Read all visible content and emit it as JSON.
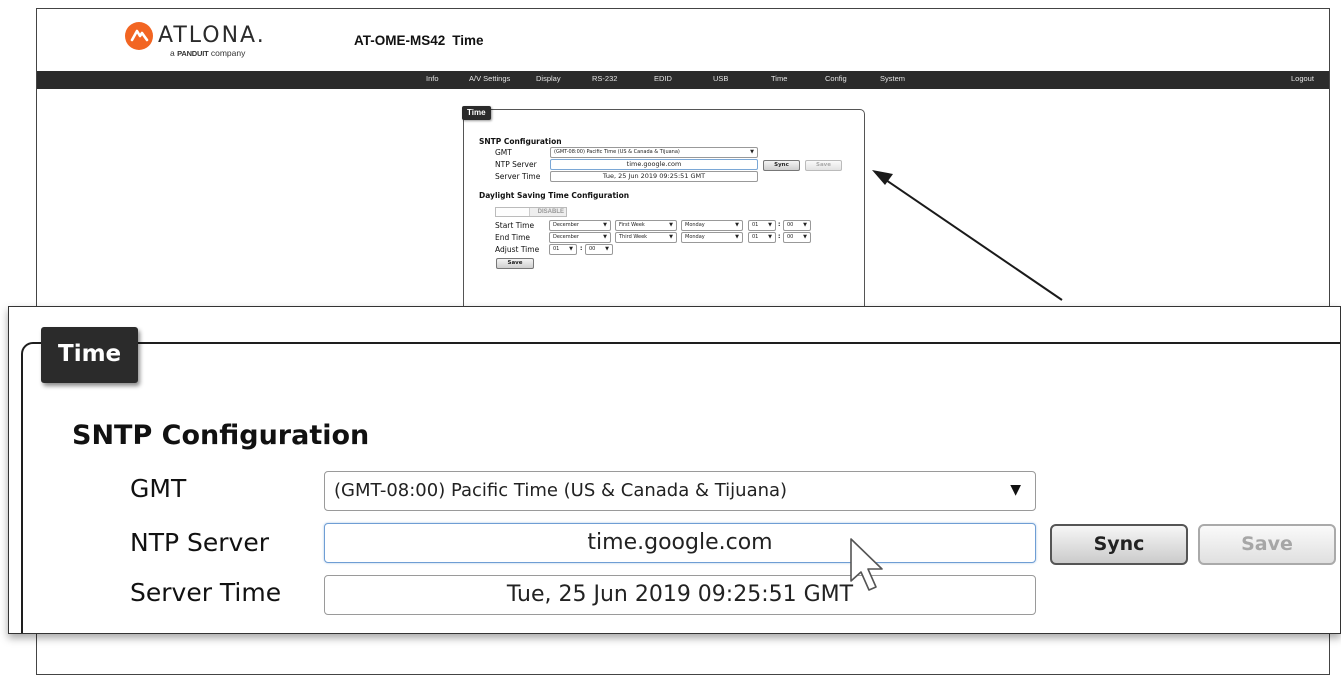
{
  "header": {
    "logo_word": "ATLONA.",
    "logo_sub_prefix": "a",
    "logo_sub_brand": "PANDUIT",
    "logo_sub_suffix": "company",
    "model": "AT-OME-MS42",
    "page_name": "Time"
  },
  "nav": {
    "items": [
      "Info",
      "A/V Settings",
      "Display",
      "RS-232",
      "EDID",
      "USB",
      "Time",
      "Config",
      "System"
    ],
    "logout": "Logout"
  },
  "time_panel": {
    "title": "Time",
    "sntp": {
      "heading": "SNTP Configuration",
      "gmt_label": "GMT",
      "gmt_value": "(GMT-08:00) Pacific Time (US & Canada & Tijuana)",
      "ntp_label": "NTP Server",
      "ntp_value": "time.google.com",
      "server_time_label": "Server Time",
      "server_time_value": "Tue, 25 Jun 2019 09:25:51 GMT",
      "sync_label": "Sync",
      "save_label": "Save"
    },
    "dst": {
      "heading": "Daylight Saving Time Configuration",
      "toggle_label": "DISABLE",
      "start_label": "Start Time",
      "start_month": "December",
      "start_week": "First Week",
      "start_day": "Monday",
      "start_hour": "01",
      "start_min": "00",
      "end_label": "End Time",
      "end_month": "December",
      "end_week": "Third Week",
      "end_day": "Monday",
      "end_hour": "01",
      "end_min": "00",
      "adjust_label": "Adjust Time",
      "adjust_hour": "01",
      "adjust_min": "00",
      "save_label": "Save"
    }
  },
  "icons": {
    "dropdown": "▼",
    "colon": ":"
  },
  "colors": {
    "navbar_bg": "#2b2b2b",
    "logo_orange": "#f26522",
    "focus_border": "#6f9ed4"
  }
}
